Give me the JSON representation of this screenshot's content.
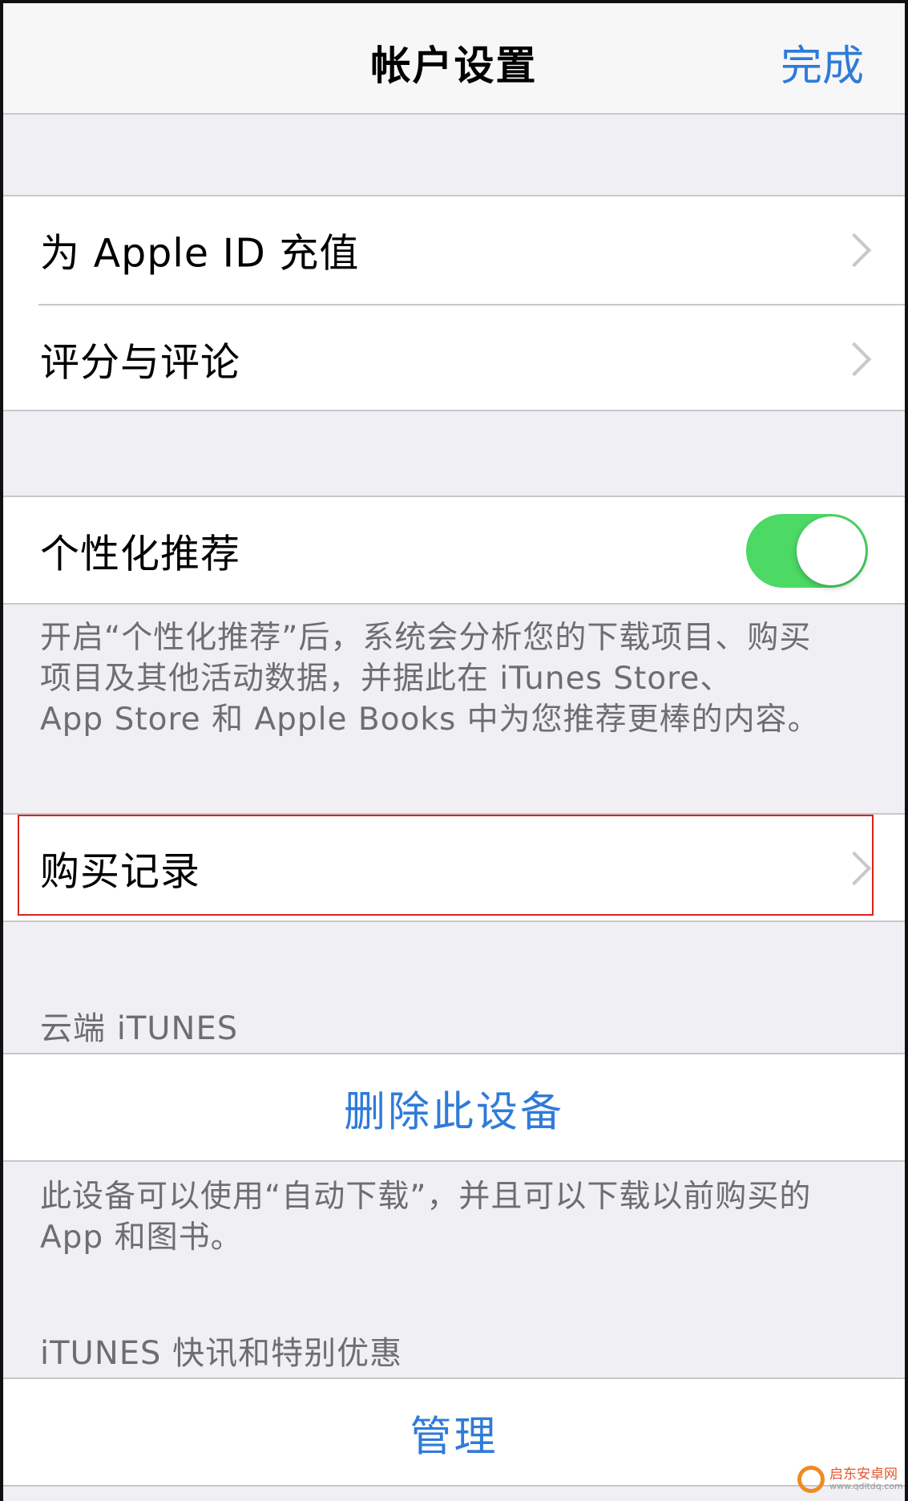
{
  "navbar": {
    "title": "帐户设置",
    "done_label": "完成"
  },
  "group1": {
    "items": [
      {
        "label": "为 Apple ID 充值"
      },
      {
        "label": "评分与评论"
      }
    ]
  },
  "personalization": {
    "label": "个性化推荐",
    "toggle_on": true,
    "footnote_lines": [
      "开启“个性化推荐”后，系统会分析您的下载项目、购买",
      "项目及其他活动数据，并据此在 iTunes Store、",
      "App Store 和 Apple Books 中为您推荐更棒的内容。"
    ]
  },
  "purchase_history": {
    "label": "购买记录"
  },
  "cloud_itunes": {
    "header": "云端 iTUNES",
    "action_label": "删除此设备",
    "footnote_lines": [
      "此设备可以使用“自动下载”，并且可以下载以前购买的",
      "App 和图书。"
    ]
  },
  "newsletter": {
    "header": "iTUNES 快讯和特别优惠",
    "action_label": "管理"
  },
  "watermark": {
    "text": "启东安卓网",
    "url": "www.qdltdq.com"
  },
  "colors": {
    "accent": "#2f7bd9",
    "toggle_on": "#4cd964",
    "highlight": "#d9231f",
    "background": "#efeff4"
  }
}
